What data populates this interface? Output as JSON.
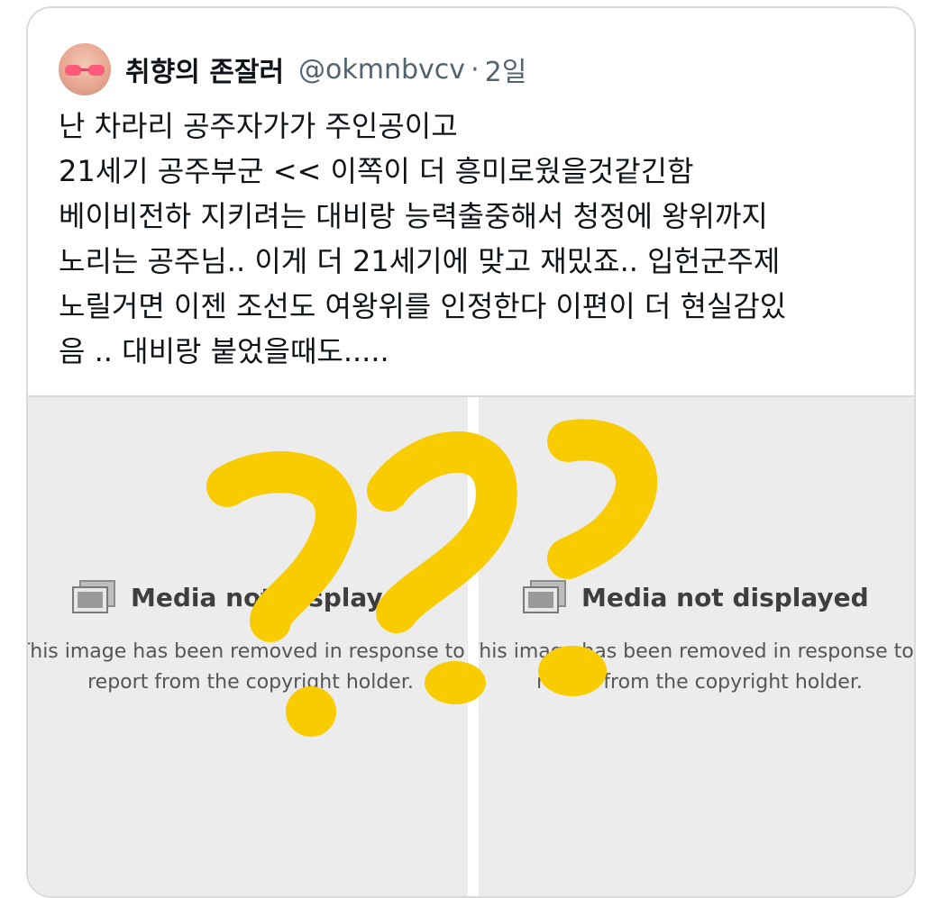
{
  "tweet": {
    "author_name": "취향의 존잘러",
    "handle": "@okmnbvcv",
    "separator": "·",
    "time": "2일",
    "lines": [
      "난 차라리 공주자가가 주인공이고",
      "21세기 공주부군 << 이쪽이 더 흥미로웠을것같긴함",
      "베이비전하 지키려는 대비랑 능력출중해서 청정에 왕위까지",
      "노리는 공주님.. 이게 더 21세기에 맞고 재밌죠.. 입헌군주제",
      "노릴거면 이젠 조선도 여왕위를 인정한다 이편이 더 현실감있",
      "음 .. 대비랑 붙었을때도....."
    ]
  },
  "media": [
    {
      "title": "Media not displayed",
      "line1": "This image has been removed in response to a",
      "line2": "report from the copyright holder."
    },
    {
      "title": "Media not displayed",
      "line1": "This image has been removed in response to a",
      "line2": "report from the copyright holder."
    }
  ],
  "colors": {
    "annotation": "#f8cc00",
    "handle": "#536471",
    "text": "#0f1419",
    "border": "#d5dbe0",
    "media_bg": "#ececec"
  },
  "icons": [
    "avatar-image",
    "media-placeholder-icon"
  ]
}
